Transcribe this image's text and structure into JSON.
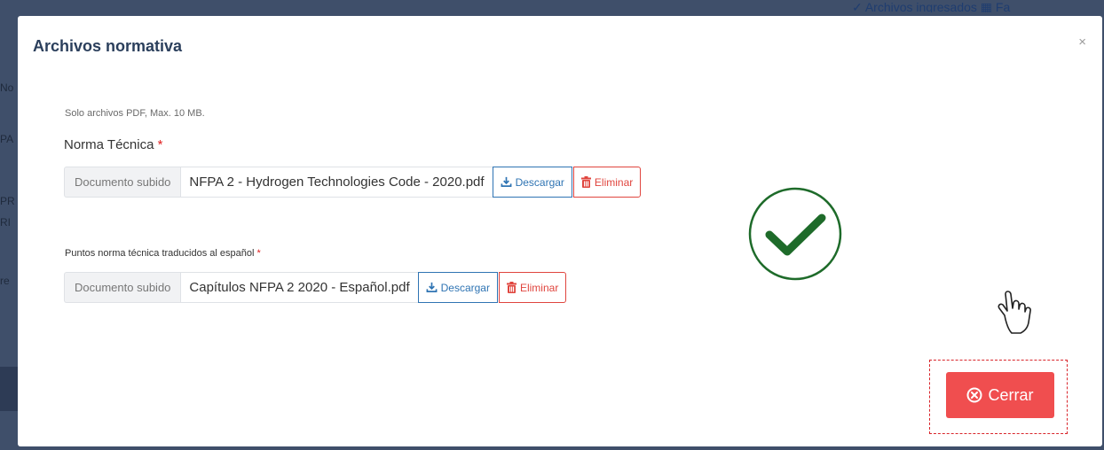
{
  "background": {
    "topbar_text": "✓ Archivos ingresados   ▦ Fa",
    "fragments": [
      "No",
      "PA",
      "PR",
      "RI",
      "re"
    ]
  },
  "modal": {
    "title": "Archivos normativa",
    "close_symbol": "×",
    "hint": "Solo archivos PDF, Max. 10 MB.",
    "fields": [
      {
        "label": "Norma Técnica",
        "required_mark": "*",
        "addon": "Documento subido",
        "filename": "NFPA 2 - Hydrogen Technologies Code - 2020.pdf",
        "download_label": "Descargar",
        "delete_label": "Eliminar"
      },
      {
        "label": "Puntos norma técnica traducidos al español",
        "required_mark": "*",
        "addon": "Documento subido",
        "filename": "Capítulos NFPA 2 2020 - Español.pdf",
        "download_label": "Descargar",
        "delete_label": "Eliminar"
      }
    ],
    "close_button_label": "Cerrar"
  },
  "colors": {
    "primary": "#2f74b3",
    "danger": "#e0453e",
    "close_button": "#f04e4f",
    "success": "#1e6b2a",
    "title": "#2b3f5c"
  },
  "icons": {
    "download": "download-icon",
    "delete": "trash-icon",
    "success": "check-circle-icon",
    "close_button": "x-circle-icon",
    "cursor": "hand-pointer-icon"
  }
}
